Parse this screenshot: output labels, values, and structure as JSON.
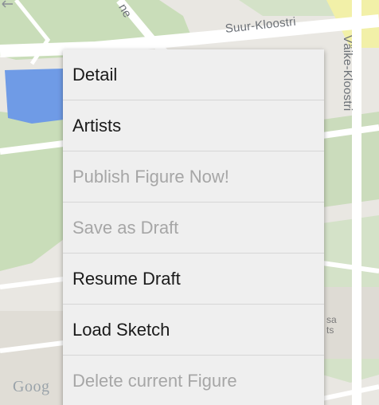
{
  "map": {
    "streets": {
      "suur_kloostri": "Suur-Kloostri",
      "vaike_kloostri": "Väike-Kloostri",
      "partial_top": "ne"
    },
    "poi_partial": [
      "sa",
      "ts"
    ],
    "logo": "Goog",
    "colors": {
      "land": "#e9e7e2",
      "park": "#c6ddb8",
      "water": "#6f9be6",
      "road": "#ffffff",
      "highlight": "#f2f0a8"
    }
  },
  "menu": {
    "items": [
      {
        "label": "Detail",
        "enabled": true
      },
      {
        "label": "Artists",
        "enabled": true
      },
      {
        "label": "Publish Figure Now!",
        "enabled": false
      },
      {
        "label": "Save as Draft",
        "enabled": false
      },
      {
        "label": "Resume Draft",
        "enabled": true
      },
      {
        "label": "Load Sketch",
        "enabled": true
      },
      {
        "label": "Delete current Figure",
        "enabled": false
      }
    ]
  }
}
